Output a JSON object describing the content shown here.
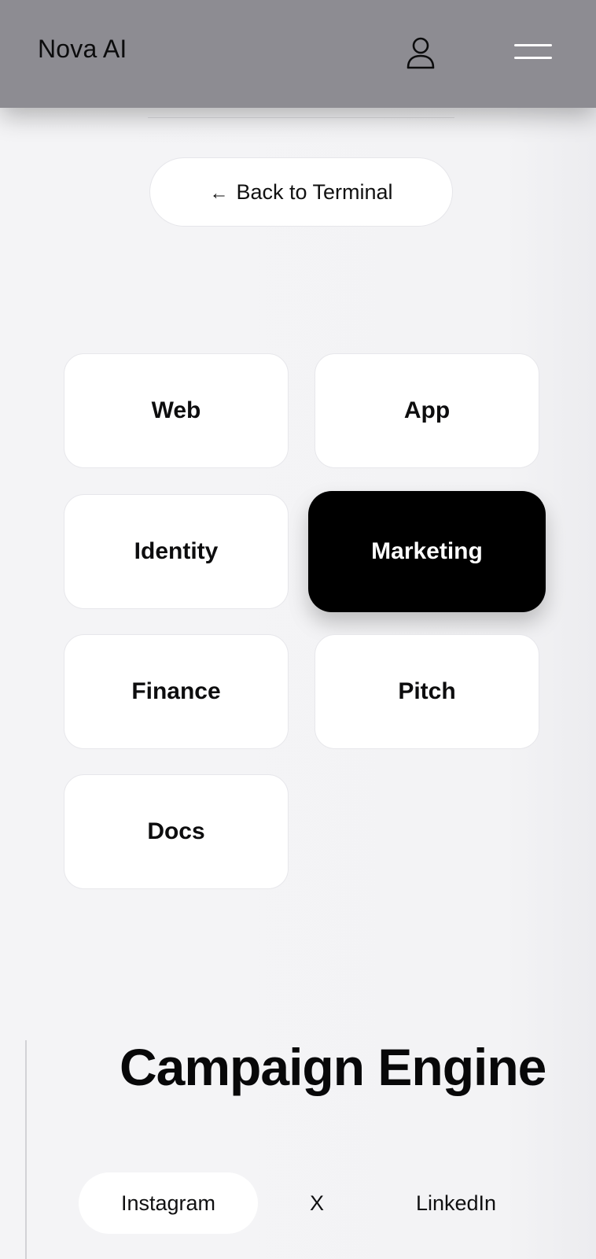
{
  "header": {
    "brand": "Nova AI",
    "icons": [
      "user-icon",
      "hamburger-menu-icon"
    ]
  },
  "back_button": {
    "arrow": "←",
    "label": "Back to Terminal"
  },
  "categories": [
    {
      "label": "Web",
      "active": false
    },
    {
      "label": "App",
      "active": false
    },
    {
      "label": "Identity",
      "active": false
    },
    {
      "label": "Marketing",
      "active": true
    },
    {
      "label": "Finance",
      "active": false
    },
    {
      "label": "Pitch",
      "active": false
    },
    {
      "label": "Docs",
      "active": false
    }
  ],
  "section": {
    "title": "Campaign Engine"
  },
  "platform_tabs": [
    {
      "label": "Instagram",
      "active": true
    },
    {
      "label": "X",
      "active": false
    },
    {
      "label": "LinkedIn",
      "active": false
    }
  ],
  "colors": {
    "header_bg": "#8d8c92",
    "page_bg": "#f3f3f5",
    "active_card_bg": "#000000",
    "card_bg": "#ffffff"
  }
}
